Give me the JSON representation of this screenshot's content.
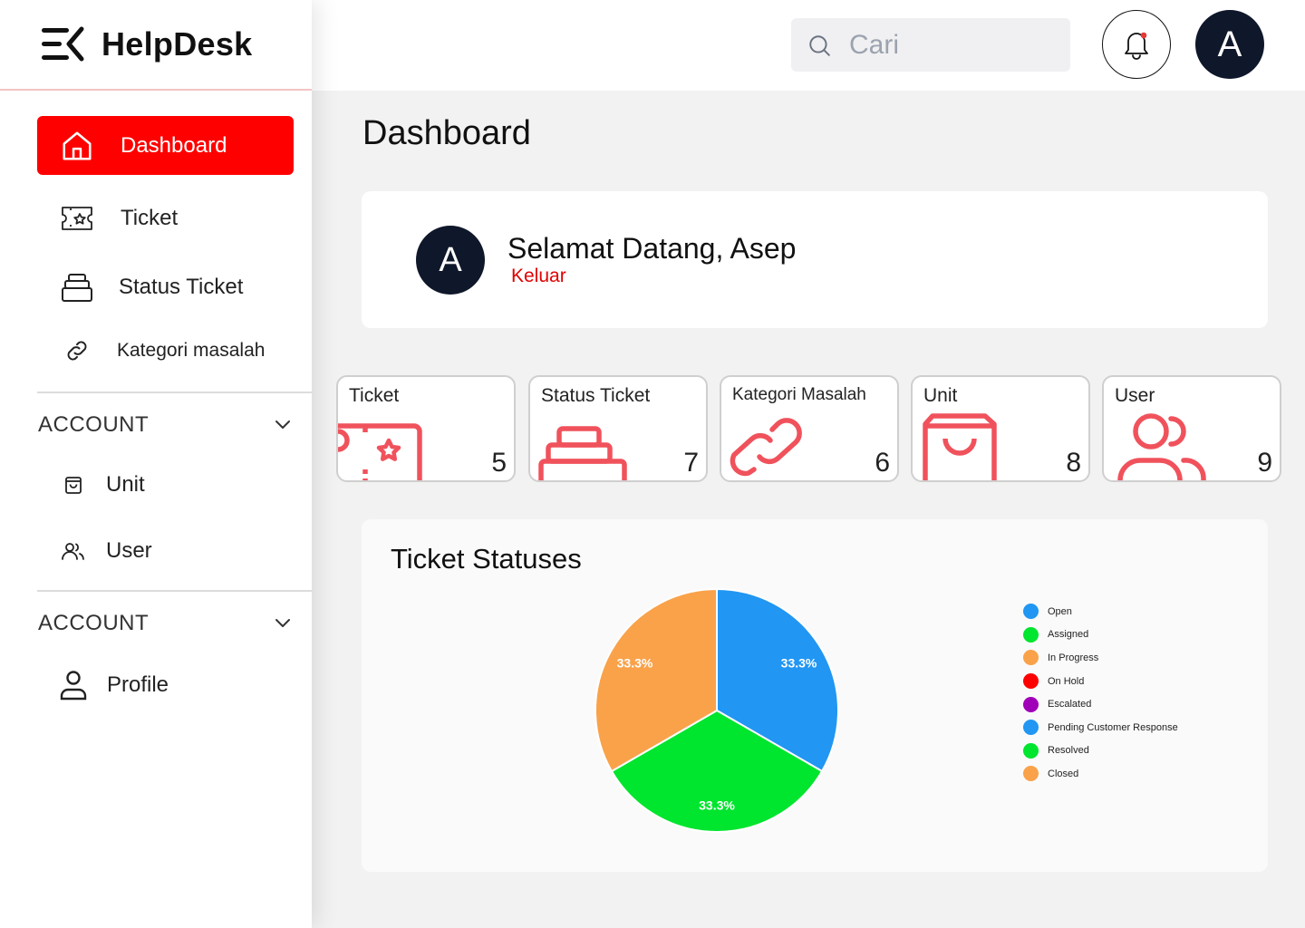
{
  "app": {
    "name": "HelpDesk"
  },
  "sidebar": {
    "items": [
      {
        "label": "Dashboard",
        "icon": "home-icon",
        "active": true
      },
      {
        "label": "Ticket",
        "icon": "ticket-icon"
      },
      {
        "label": "Status Ticket",
        "icon": "stack-icon"
      },
      {
        "label": "Kategori masalah",
        "icon": "link-icon"
      }
    ],
    "section1": {
      "label": "ACCOUNT",
      "items": [
        {
          "label": "Unit",
          "icon": "bag-icon"
        },
        {
          "label": "User",
          "icon": "users-icon"
        }
      ]
    },
    "section2": {
      "label": "ACCOUNT",
      "items": [
        {
          "label": "Profile",
          "icon": "user-icon"
        }
      ]
    }
  },
  "topbar": {
    "search_placeholder": "Cari",
    "avatar_initial": "A",
    "notification_color": "#e53935"
  },
  "main": {
    "title": "Dashboard",
    "welcome": {
      "avatar_initial": "A",
      "greeting": "Selamat Datang, Asep",
      "logout": "Keluar"
    },
    "cards": [
      {
        "title": "Ticket",
        "count": "5",
        "icon": "ticket-icon"
      },
      {
        "title": "Status Ticket",
        "count": "7",
        "icon": "stack-icon"
      },
      {
        "title": "Kategori Masalah",
        "count": "6",
        "icon": "link-icon"
      },
      {
        "title": "Unit",
        "count": "8",
        "icon": "bag-icon"
      },
      {
        "title": "User",
        "count": "9",
        "icon": "users-icon"
      }
    ]
  },
  "colors": {
    "accent": "#ff0000",
    "icon_red": "#f0525c",
    "dark": "#0f172a"
  },
  "chart_data": {
    "type": "pie",
    "title": "Ticket Statuses",
    "legend_position": "right",
    "categories": [
      "Open",
      "Assigned",
      "In Progress",
      "On Hold",
      "Escalated",
      "Pending Customer Response",
      "Resolved",
      "Closed"
    ],
    "colors": [
      "#2196f3",
      "#00e52e",
      "#f9a24a",
      "#ff0000",
      "#a000b8",
      "#2196f3",
      "#00e52e",
      "#f9a24a"
    ],
    "values": [
      1,
      1,
      1,
      0,
      0,
      0,
      0,
      0
    ],
    "slice_labels": [
      "33.3%",
      "33.3%",
      "33.3%"
    ]
  }
}
